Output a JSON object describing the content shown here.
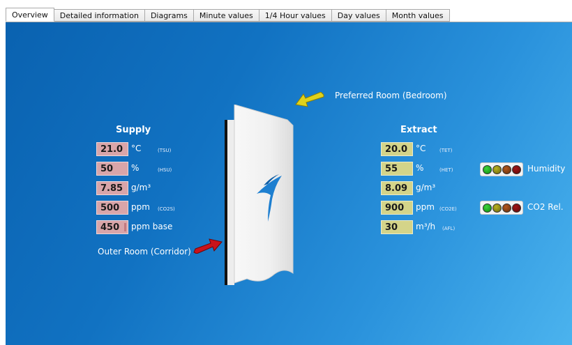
{
  "tabs": [
    {
      "label": "Overview",
      "active": true
    },
    {
      "label": "Detailed information",
      "active": false
    },
    {
      "label": "Diagrams",
      "active": false
    },
    {
      "label": "Minute values",
      "active": false
    },
    {
      "label": "1/4 Hour values",
      "active": false
    },
    {
      "label": "Day values",
      "active": false
    },
    {
      "label": "Month values",
      "active": false
    }
  ],
  "labels": {
    "preferred_room": "Preferred Room (Bedroom)",
    "outer_room": "Outer Room (Corridor)"
  },
  "supply": {
    "heading": "Supply",
    "rows": [
      {
        "value": "21.0",
        "unit": "°C",
        "tag": "(TSU)"
      },
      {
        "value": "50",
        "unit": "%",
        "tag": "(HSU)"
      },
      {
        "value": "7.85",
        "unit": "g/m³",
        "tag": ""
      },
      {
        "value": "500",
        "unit": "ppm",
        "tag": "(CO2S)"
      },
      {
        "value": "450",
        "unit": "ppm base",
        "tag": ""
      }
    ]
  },
  "extract": {
    "heading": "Extract",
    "rows": [
      {
        "value": "20.0",
        "unit": "°C",
        "tag": "(TET)"
      },
      {
        "value": "55",
        "unit": "%",
        "tag": "(HET)"
      },
      {
        "value": "8.09",
        "unit": "g/m³",
        "tag": ""
      },
      {
        "value": "900",
        "unit": "ppm",
        "tag": "(CO2E)"
      },
      {
        "value": "30",
        "unit": "m³/h",
        "tag": "(AFL)"
      }
    ]
  },
  "indicators": [
    {
      "label": "Humidity"
    },
    {
      "label": "CO2 Rel."
    }
  ],
  "colors": {
    "supply_field": "#d9a5a9",
    "extract_field": "#d4d489",
    "background": "#1172c2",
    "arrow_preferred": "#e0d21a",
    "arrow_outer": "#c8131b"
  }
}
